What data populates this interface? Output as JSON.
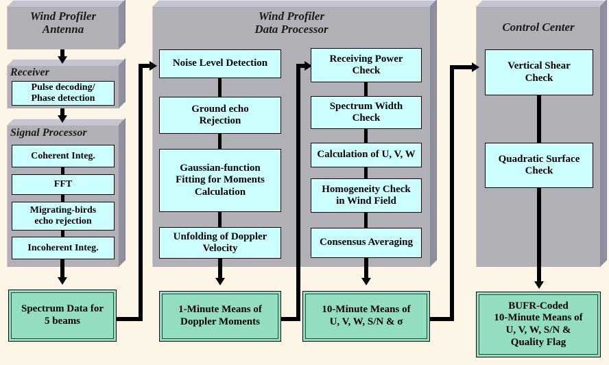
{
  "figure": {
    "background_color": "#fdf6e6",
    "panel_color": "#b0b0b6",
    "process_box_color": "#ccffff",
    "output_box_color": "#93ddc0"
  },
  "panels": {
    "antenna": {
      "title": "Wind Profiler\nAntenna"
    },
    "receiver": {
      "title": "Receiver"
    },
    "signal_processor": {
      "title": "Signal Processor"
    },
    "data_processor": {
      "title": "Wind Profiler\nData Processor"
    },
    "control_center": {
      "title": "Control Center"
    }
  },
  "receiver_steps": [
    {
      "label": "Pulse decoding/\nPhase detection"
    }
  ],
  "signal_processor_steps": [
    {
      "label": "Coherent Integ."
    },
    {
      "label": "FFT"
    },
    {
      "label": "Migrating-birds\necho rejection"
    },
    {
      "label": "Incoherent Integ."
    }
  ],
  "data_processor_column_1": [
    {
      "label": "Noise Level Detection"
    },
    {
      "label": "Ground echo\nRejection"
    },
    {
      "label": "Gaussian-function\nFitting for Moments\nCalculation"
    },
    {
      "label": "Unfolding of Doppler\nVelocity"
    }
  ],
  "data_processor_column_2": [
    {
      "label": "Receiving Power\nCheck"
    },
    {
      "label": "Spectrum Width\nCheck"
    },
    {
      "label": "Calculation of U, V, W"
    },
    {
      "label": "Homogeneity Check\nin Wind Field"
    },
    {
      "label": "Consensus Averaging"
    }
  ],
  "control_center_steps": [
    {
      "label": "Vertical Shear\nCheck"
    },
    {
      "label": "Quadratic Surface\nCheck"
    }
  ],
  "outputs": [
    {
      "label": "Spectrum Data for\n5 beams"
    },
    {
      "label": "1-Minute Means of\nDoppler Moments"
    },
    {
      "label": "10-Minute Means of\nU, V, W, S/N & σ"
    },
    {
      "label": "BUFR-Coded\n10-Minute Means of\nU, V, W, S/N &\nQuality Flag"
    }
  ]
}
